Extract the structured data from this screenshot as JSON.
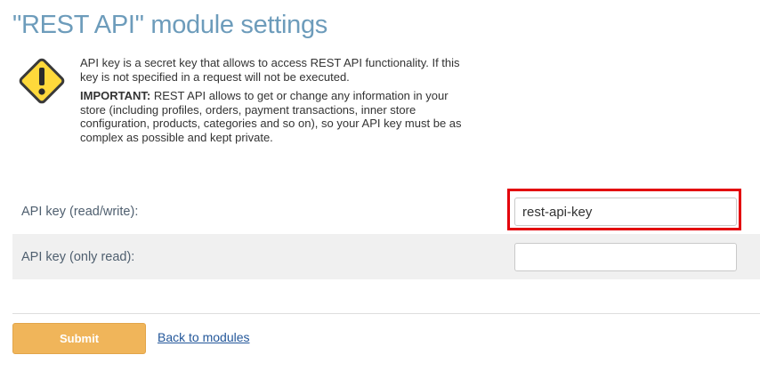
{
  "page": {
    "title": "\"REST API\" module settings"
  },
  "warning": {
    "icon": "warning-icon",
    "paragraph1": "API key is a secret key that allows to access REST API functionality. If this key is not specified in a request will not be executed.",
    "important_label": "IMPORTANT:",
    "paragraph2": "REST API allows to get or change any information in your store (including profiles, orders, payment transactions, inner store configuration, products, categories and so on), so your API key must be as complex as possible and kept private."
  },
  "settings": {
    "rows": [
      {
        "label": "API key (read/write):",
        "value": "rest-api-key"
      },
      {
        "label": "API key (only read):",
        "value": ""
      }
    ]
  },
  "actions": {
    "submit_label": "Submit",
    "back_label": "Back to modules"
  },
  "colors": {
    "title": "#6d9cbb",
    "submit_bg": "#f0b55a",
    "highlight": "#e3000b",
    "link": "#23579a"
  }
}
